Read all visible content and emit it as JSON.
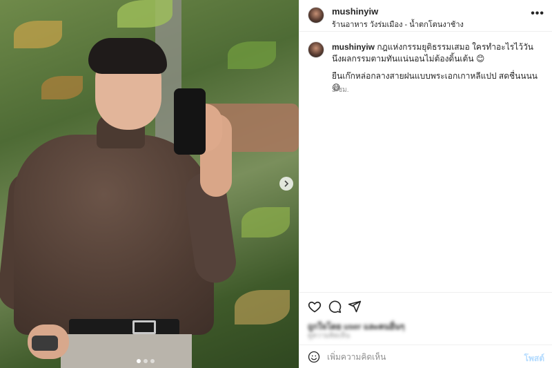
{
  "media": {
    "image_description_icon": "photo",
    "carousel_next_icon": "chevron-right-icon",
    "carousel_total": 3,
    "carousel_active": 1
  },
  "post": {
    "username": "mushinyiw",
    "location": "ร้านอาหาร วังร่มเมือง - น้ำตกโตนงาช้าง",
    "more_icon": "more-horizontal-icon",
    "more_label": "•••"
  },
  "caption": {
    "username": "mushinyiw",
    "line1": " กฎแห่งกรรมยุติธรรมเสมอ ใครทำอะไรไว้วันนึงผลกรรมตามทันแน่นอนไม่ต้องดิ้นเต้น 😊",
    "line2": "ยืนเก๊กหล่อกลางสายฝนแบบพระเอกเกาหลีแปป สดชื่นนนน😅",
    "time": "3 ชม."
  },
  "actions": {
    "like_icon": "heart-icon",
    "comment_icon": "comment-icon",
    "share_icon": "send-icon"
  },
  "likes": {
    "text": "ถูกใจโดย user และคนอื่นๆ",
    "sub": "ดูความคิดเห็น"
  },
  "comment": {
    "placeholder": "เพิ่มความคิดเห็น",
    "post_label": "โพสต์",
    "emoji_icon": "smiley-icon"
  },
  "colors": {
    "border": "#efefef",
    "text": "#262626",
    "muted": "#8e8e8e",
    "post_disabled": "#b3dbff"
  }
}
